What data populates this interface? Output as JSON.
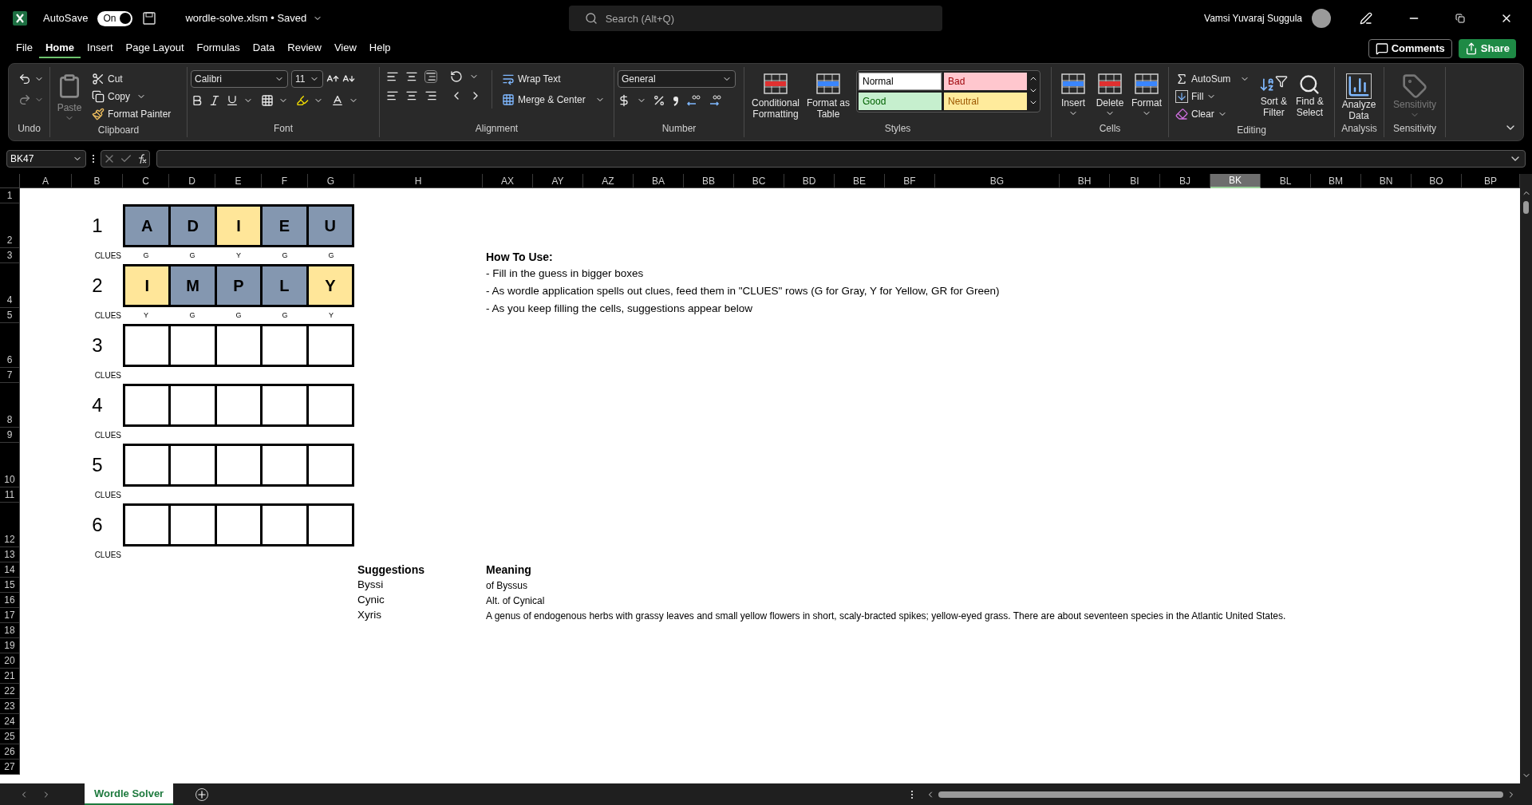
{
  "title_bar": {
    "autosave_label": "AutoSave",
    "autosave_toggle": {
      "label": "On",
      "on": true
    },
    "file_name": "wordle-solve.xlsm • Saved",
    "search": {
      "placeholder": "Search (Alt+Q)"
    },
    "user_name": "Vamsi Yuvaraj Suggula"
  },
  "menu_tabs": [
    {
      "label": "File",
      "selected": false
    },
    {
      "label": "Home",
      "selected": true
    },
    {
      "label": "Insert",
      "selected": false
    },
    {
      "label": "Page Layout",
      "selected": false
    },
    {
      "label": "Formulas",
      "selected": false
    },
    {
      "label": "Data",
      "selected": false
    },
    {
      "label": "Review",
      "selected": false
    },
    {
      "label": "View",
      "selected": false
    },
    {
      "label": "Help",
      "selected": false
    }
  ],
  "header_buttons": {
    "comments": "Comments",
    "share": "Share"
  },
  "ribbon": {
    "undo": {
      "label": "Undo"
    },
    "clipboard": {
      "label": "Clipboard",
      "paste": {
        "label": "Paste",
        "disabled": true
      },
      "cut": "Cut",
      "copy": "Copy",
      "format_painter": "Format Painter"
    },
    "font": {
      "label": "Font",
      "font_name": "Calibri",
      "font_size": "11"
    },
    "alignment": {
      "label": "Alignment",
      "wrap_text": "Wrap Text",
      "merge_center": "Merge & Center"
    },
    "number": {
      "label": "Number",
      "format": "General"
    },
    "styles": {
      "label": "Styles",
      "conditional_formatting": "Conditional Formatting",
      "format_as_table": "Format as Table",
      "cell_styles": [
        {
          "name": "Normal",
          "kind": "normal",
          "selected": true
        },
        {
          "name": "Bad",
          "kind": "bad",
          "selected": false
        },
        {
          "name": "Good",
          "kind": "good",
          "selected": false
        },
        {
          "name": "Neutral",
          "kind": "neutral",
          "selected": false
        }
      ]
    },
    "cells": {
      "label": "Cells",
      "insert": "Insert",
      "delete": "Delete",
      "format": "Format"
    },
    "editing": {
      "label": "Editing",
      "autosum": "AutoSum",
      "fill": "Fill",
      "clear": "Clear",
      "sort_filter": "Sort & Filter",
      "find_select": "Find & Select"
    },
    "analysis": {
      "label": "Analysis",
      "analyze_data": "Analyze Data"
    },
    "sensitivity": {
      "label": "Sensitivity",
      "button": {
        "label": "Sensitivity",
        "disabled": true
      }
    }
  },
  "formula_bar": {
    "name_box": "BK47"
  },
  "columns": [
    {
      "label": "A",
      "selected": false
    },
    {
      "label": "B",
      "selected": false
    },
    {
      "label": "C",
      "selected": false
    },
    {
      "label": "D",
      "selected": false
    },
    {
      "label": "E",
      "selected": false
    },
    {
      "label": "F",
      "selected": false
    },
    {
      "label": "G",
      "selected": false
    },
    {
      "label": "H",
      "selected": false
    },
    {
      "label": "AX",
      "selected": false
    },
    {
      "label": "AY",
      "selected": false
    },
    {
      "label": "AZ",
      "selected": false
    },
    {
      "label": "BA",
      "selected": false
    },
    {
      "label": "BB",
      "selected": false
    },
    {
      "label": "BC",
      "selected": false
    },
    {
      "label": "BD",
      "selected": false
    },
    {
      "label": "BE",
      "selected": false
    },
    {
      "label": "BF",
      "selected": false
    },
    {
      "label": "BG",
      "selected": false
    },
    {
      "label": "BH",
      "selected": false
    },
    {
      "label": "BI",
      "selected": false
    },
    {
      "label": "BJ",
      "selected": false
    },
    {
      "label": "BK",
      "selected": true
    },
    {
      "label": "BL",
      "selected": false
    },
    {
      "label": "BM",
      "selected": false
    },
    {
      "label": "BN",
      "selected": false
    },
    {
      "label": "BO",
      "selected": false
    },
    {
      "label": "BP",
      "selected": false
    }
  ],
  "rows": [
    "1",
    "2",
    "3",
    "4",
    "5",
    "6",
    "7",
    "8",
    "9",
    "10",
    "11",
    "12",
    "13",
    "14",
    "15",
    "16",
    "17",
    "18",
    "19",
    "20",
    "21",
    "22",
    "23",
    "24",
    "25",
    "26",
    "27"
  ],
  "guesses": [
    {
      "number": "1",
      "tiles": [
        {
          "filled": true,
          "letter": "A",
          "color": "#8497b0"
        },
        {
          "filled": true,
          "letter": "D",
          "color": "#8497b0"
        },
        {
          "filled": true,
          "letter": "I",
          "color": "#ffe699"
        },
        {
          "filled": true,
          "letter": "E",
          "color": "#8497b0"
        },
        {
          "filled": true,
          "letter": "U",
          "color": "#8497b0"
        }
      ],
      "clues_label": "CLUES",
      "clues": [
        "G",
        "G",
        "Y",
        "G",
        "G"
      ]
    },
    {
      "number": "2",
      "tiles": [
        {
          "filled": true,
          "letter": "I",
          "color": "#ffe699"
        },
        {
          "filled": true,
          "letter": "M",
          "color": "#8497b0"
        },
        {
          "filled": true,
          "letter": "P",
          "color": "#8497b0"
        },
        {
          "filled": true,
          "letter": "L",
          "color": "#8497b0"
        },
        {
          "filled": true,
          "letter": "Y",
          "color": "#ffe699"
        }
      ],
      "clues_label": "CLUES",
      "clues": [
        "Y",
        "G",
        "G",
        "G",
        "Y"
      ]
    },
    {
      "number": "3",
      "tiles": [
        {
          "filled": false
        },
        {
          "filled": false
        },
        {
          "filled": false
        },
        {
          "filled": false
        },
        {
          "filled": false
        }
      ],
      "clues_label": "CLUES"
    },
    {
      "number": "4",
      "tiles": [
        {
          "filled": false
        },
        {
          "filled": false
        },
        {
          "filled": false
        },
        {
          "filled": false
        },
        {
          "filled": false
        }
      ],
      "clues_label": "CLUES"
    },
    {
      "number": "5",
      "tiles": [
        {
          "filled": false
        },
        {
          "filled": false
        },
        {
          "filled": false
        },
        {
          "filled": false
        },
        {
          "filled": false
        }
      ],
      "clues_label": "CLUES"
    },
    {
      "number": "6",
      "tiles": [
        {
          "filled": false
        },
        {
          "filled": false
        },
        {
          "filled": false
        },
        {
          "filled": false
        },
        {
          "filled": false
        }
      ],
      "clues_label": "CLUES"
    }
  ],
  "how_to_use": {
    "title": "How To Use:",
    "lines": [
      "- Fill in the guess in bigger boxes",
      "- As wordle application spells out clues, feed them in \"CLUES\" rows (G for Gray, Y for Yellow, GR for Green)",
      "- As you keep filling the cells, suggestions appear below"
    ]
  },
  "suggestions": {
    "word_header": "Suggestions",
    "meaning_header": "Meaning",
    "items": [
      {
        "word": "Byssi",
        "meaning": "of Byssus"
      },
      {
        "word": "Cynic",
        "meaning": "Alt. of Cynical"
      },
      {
        "word": "Xyris",
        "meaning": "A genus of endogenous herbs with grassy leaves and small yellow flowers in short, scaly-bracted spikes; yellow-eyed grass. There are about seventeen species in the Atlantic United States."
      }
    ]
  },
  "sheet_tabs": [
    {
      "label": "Wordle Solver",
      "selected": true
    }
  ]
}
